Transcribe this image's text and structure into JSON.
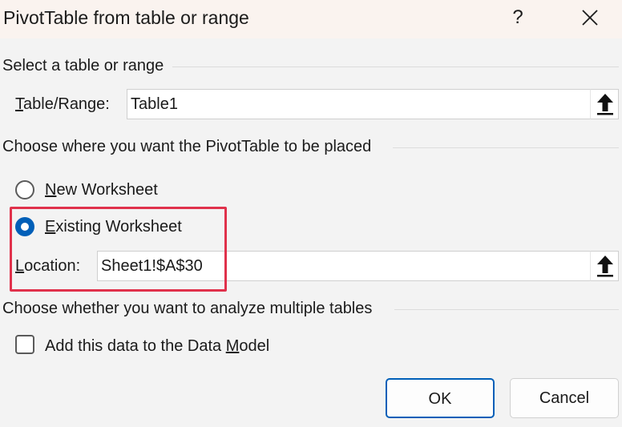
{
  "dialog": {
    "title": "PivotTable from table or range",
    "help_glyph": "?",
    "close_icon": "close-icon"
  },
  "source": {
    "section_label": "Select a table or range",
    "field_label_key": "T",
    "field_label_rest": "able/Range:",
    "value": "Table1"
  },
  "placement": {
    "section_label": "Choose where you want the PivotTable to be placed",
    "new_worksheet": {
      "key": "N",
      "rest": "ew Worksheet",
      "selected": false
    },
    "existing_worksheet": {
      "key": "E",
      "rest": "xisting Worksheet",
      "selected": true
    },
    "location_label_key": "L",
    "location_label_rest": "ocation:",
    "location_value": "Sheet1!$A$30"
  },
  "multiple": {
    "section_label": "Choose whether you want to analyze multiple tables",
    "checkbox_label_pre": "Add this data to the Data ",
    "checkbox_label_key": "M",
    "checkbox_label_post": "odel",
    "checked": false
  },
  "buttons": {
    "ok": "OK",
    "cancel": "Cancel"
  },
  "colors": {
    "accent": "#005fb8",
    "highlight": "#e0314b",
    "titlebar": "#faf3ef"
  }
}
